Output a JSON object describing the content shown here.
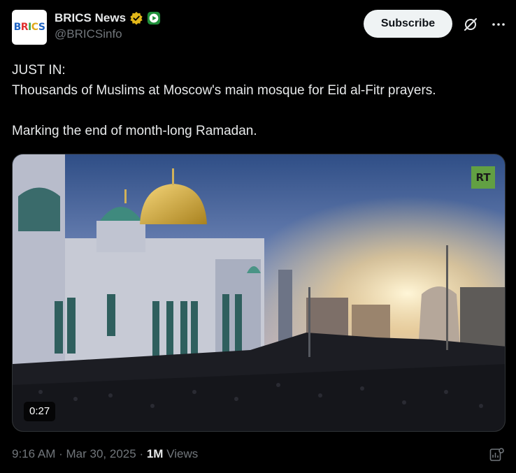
{
  "author": {
    "avatar_text": "BRICS",
    "display_name": "BRICS News",
    "handle": "@BRICSinfo"
  },
  "actions": {
    "subscribe_label": "Subscribe"
  },
  "tweet": {
    "line1_prefix": "JUST IN:",
    "line1_text": "Thousands of Muslims at Moscow's main mosque for Eid al-Fitr prayers.",
    "line2": "Marking the end of month-long Ramadan."
  },
  "media": {
    "watermark": "RT",
    "duration": "0:27"
  },
  "meta": {
    "time": "9:16 AM",
    "separator": "·",
    "date": "Mar 30, 2025",
    "views_count": "1M",
    "views_label": "Views"
  },
  "icons": {
    "verified": "gold-verified-badge",
    "affiliate": "green-play-badge",
    "grok": "grok-icon",
    "more": "more-dots-icon",
    "analytics": "analytics-icon",
    "flag": "russia-flag-icon"
  },
  "colors": {
    "background": "#000000",
    "text": "#e7e9ea",
    "secondary": "#71767b",
    "subscribe_bg": "#eff3f4",
    "verified_gold": "#e2b719",
    "rt_green": "#62a043"
  }
}
